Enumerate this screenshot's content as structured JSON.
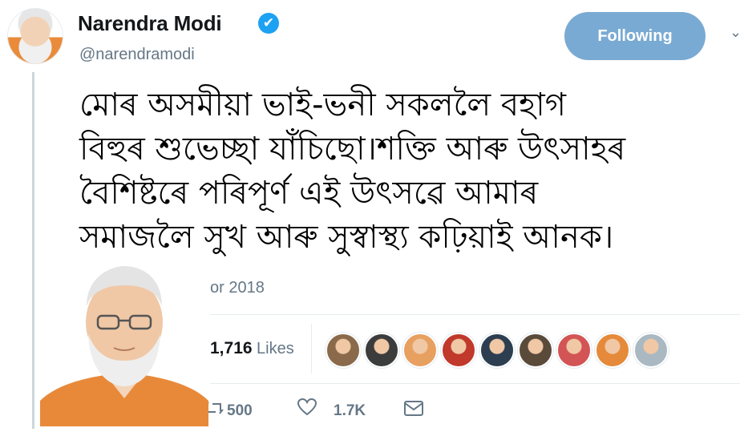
{
  "header": {
    "name": "Narendra Modi",
    "handle": "@narendramodi",
    "follow_label": "Following",
    "verified_icon": "✔"
  },
  "tweet": {
    "lines": [
      "মোৰ অসমীয়া ভাই-ভনী সকললৈ বহাগ",
      "বিহুৰ শুভেচ্ছা যাঁচিছো।শক্তি আৰু উৎসাহৰ",
      "বৈশিষ্টৰে পৰিপূৰ্ণ এই উৎসৱে আমাৰ",
      "সমাজলৈ সুখ আৰু সুস্বাস্থ্য কঢ়িয়াই আনক।"
    ],
    "date_visible": "or 2018"
  },
  "stats": {
    "likes_count": "1,716",
    "likes_label": "Likes",
    "avatar_colors": [
      "#8a6a4a",
      "#3c3c3c",
      "#e8a060",
      "#c0392b",
      "#2c3e50",
      "#5a4a3a",
      "#d35454",
      "#e58a3a",
      "#aab8c2"
    ]
  },
  "actions": {
    "retweet_count": "500",
    "like_count": "1.7K"
  },
  "colors": {
    "accent": "#1da1f2",
    "follow_button": "#79aad3",
    "secondary_text": "#657786"
  }
}
